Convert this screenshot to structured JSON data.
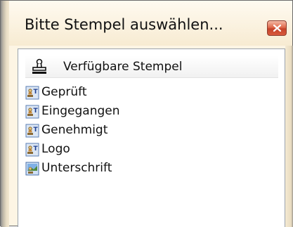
{
  "window": {
    "title": "Bitte Stempel auswählen..."
  },
  "tree": {
    "root_label": "Verfügbare Stempel",
    "items": [
      {
        "label": "Geprüft",
        "icon": "text-stamp-icon"
      },
      {
        "label": "Eingegangen",
        "icon": "text-stamp-icon"
      },
      {
        "label": "Genehmigt",
        "icon": "text-stamp-icon"
      },
      {
        "label": "Logo",
        "icon": "text-stamp-icon"
      },
      {
        "label": "Unterschrift",
        "icon": "image-stamp-icon"
      }
    ]
  },
  "colors": {
    "frame": "#fdf5e4",
    "close_button": "#d85a3e",
    "list_background": "#ffffff"
  }
}
